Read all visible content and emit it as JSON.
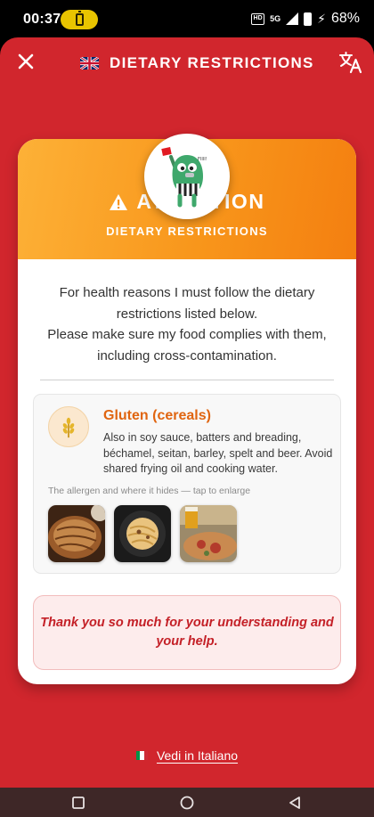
{
  "status_bar": {
    "time": "00:37",
    "network_5g": "5G",
    "hd_badge": "HD",
    "battery_percent": "68%"
  },
  "header": {
    "title": "DIETARY RESTRICTIONS",
    "flag_icon": "uk-flag-icon",
    "close_icon": "close-icon",
    "translate_icon": "translate-icon"
  },
  "card": {
    "mascot_icon": "referee-mascot-icon",
    "attention_title": "ATTENTION",
    "attention_subtitle": "DIETARY RESTRICTIONS",
    "intro_text": "For health reasons I must follow the dietary restrictions listed below.\nPlease make sure my food complies with them, including cross-contamination.",
    "allergen": {
      "icon": "wheat-icon",
      "name": "Gluten (cereals)",
      "description": "Also in soy sauce, batters and breading, béchamel, seitan, barley, spelt and beer. Avoid shared frying oil and cooking water.",
      "photos_caption": "The allergen and where it hides — tap to enlarge",
      "photos": [
        "bread-photo",
        "pasta-photo",
        "beer-pizza-photo"
      ]
    },
    "thanks_text": "Thank you so much for your understanding and your help."
  },
  "footer": {
    "italian_link": "Vedi in Italiano",
    "flag_icon": "italy-flag-icon"
  },
  "colors": {
    "background": "#d1262d",
    "header_gradient_start": "#fdb137",
    "header_gradient_end": "#f47f10",
    "allergen_name": "#e06510",
    "thanks_text": "#c42027"
  }
}
